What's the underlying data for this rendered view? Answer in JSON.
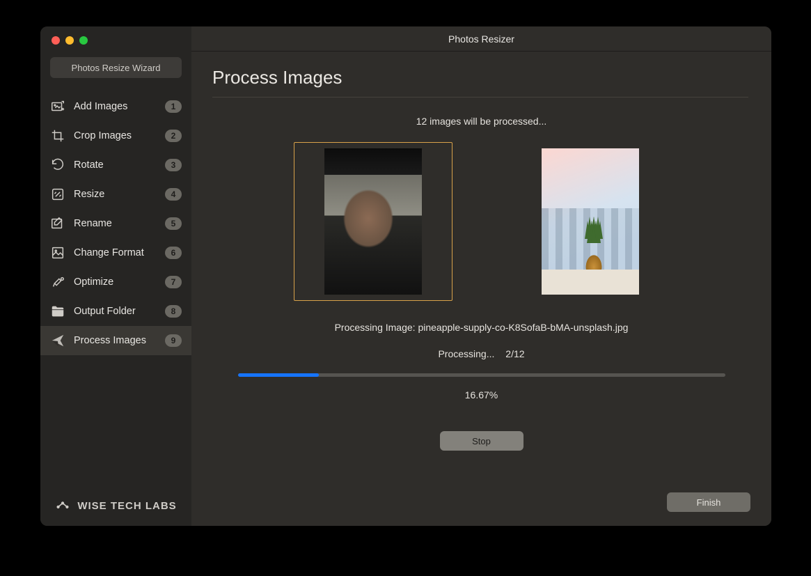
{
  "window": {
    "title": "Photos Resizer",
    "wizard_button": "Photos Resize Wizard"
  },
  "sidebar": {
    "items": [
      {
        "label": "Add Images",
        "badge": "1"
      },
      {
        "label": "Crop Images",
        "badge": "2"
      },
      {
        "label": "Rotate",
        "badge": "3"
      },
      {
        "label": "Resize",
        "badge": "4"
      },
      {
        "label": "Rename",
        "badge": "5"
      },
      {
        "label": "Change Format",
        "badge": "6"
      },
      {
        "label": "Optimize",
        "badge": "7"
      },
      {
        "label": "Output Folder",
        "badge": "8"
      },
      {
        "label": "Process Images",
        "badge": "9"
      }
    ],
    "brand": "WISE TECH LABS"
  },
  "main": {
    "page_title": "Process Images",
    "subtitle": "12 images will be processed...",
    "processing_line_prefix": "Processing Image: ",
    "processing_filename": "pineapple-supply-co-K8SofaB-bMA-unsplash.jpg",
    "status_label": "Processing...",
    "status_count": "2/12",
    "progress_percent_value": 16.67,
    "progress_percent_label": "16.67%",
    "stop_label": "Stop",
    "finish_label": "Finish"
  }
}
